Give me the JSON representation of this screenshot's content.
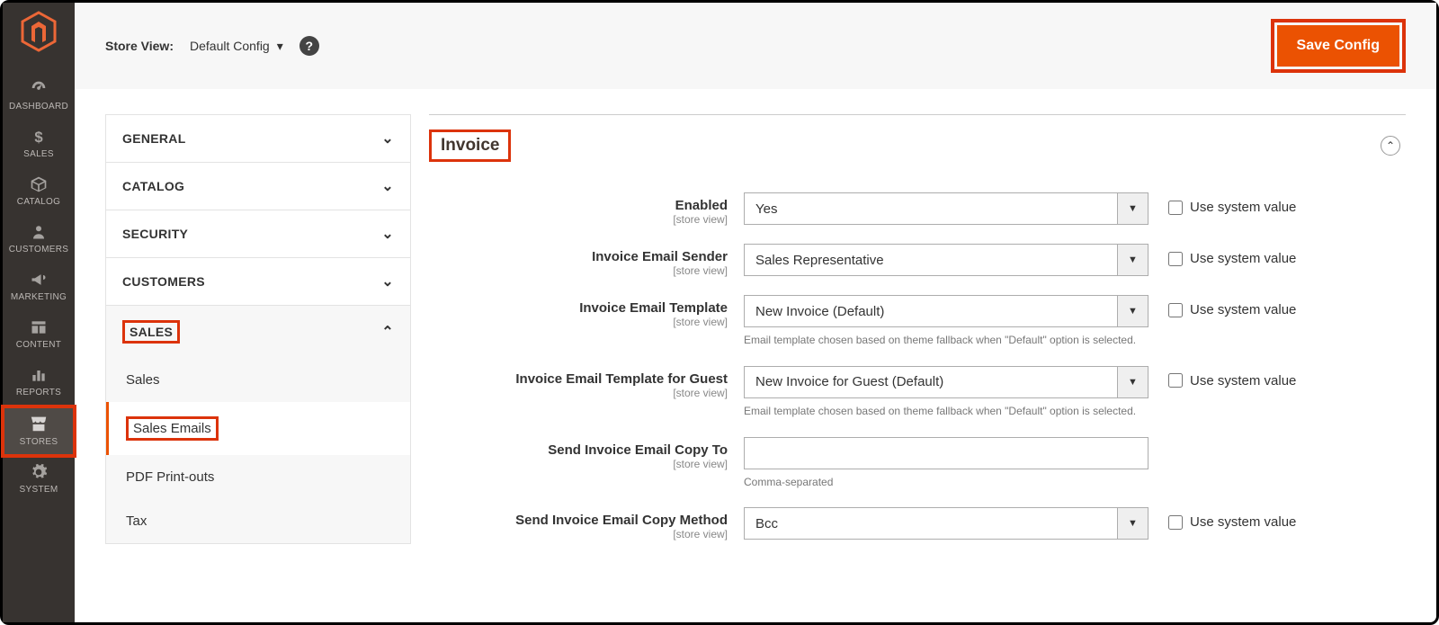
{
  "adminNav": {
    "items": [
      {
        "key": "dashboard",
        "label": "DASHBOARD"
      },
      {
        "key": "sales",
        "label": "SALES"
      },
      {
        "key": "catalog",
        "label": "CATALOG"
      },
      {
        "key": "customers",
        "label": "CUSTOMERS"
      },
      {
        "key": "marketing",
        "label": "MARKETING"
      },
      {
        "key": "content",
        "label": "CONTENT"
      },
      {
        "key": "reports",
        "label": "REPORTS"
      },
      {
        "key": "stores",
        "label": "STORES"
      },
      {
        "key": "system",
        "label": "SYSTEM"
      }
    ]
  },
  "topBar": {
    "storeViewLabel": "Store View:",
    "storeViewValue": "Default Config",
    "tooltipGlyph": "?",
    "saveLabel": "Save Config"
  },
  "configNav": {
    "sections": [
      {
        "label": "GENERAL",
        "expanded": false
      },
      {
        "label": "CATALOG",
        "expanded": false
      },
      {
        "label": "SECURITY",
        "expanded": false
      },
      {
        "label": "CUSTOMERS",
        "expanded": false
      },
      {
        "label": "SALES",
        "expanded": true,
        "highlight": true,
        "items": [
          {
            "label": "Sales"
          },
          {
            "label": "Sales Emails",
            "active": true,
            "highlight": true
          },
          {
            "label": "PDF Print-outs"
          },
          {
            "label": "Tax"
          }
        ]
      }
    ]
  },
  "settings": {
    "title": "Invoice",
    "scopeLabel": "[store view]",
    "useSystemLabel": "Use system value",
    "fields": {
      "enabled": {
        "label": "Enabled",
        "value": "Yes",
        "type": "select",
        "sys": true
      },
      "sender": {
        "label": "Invoice Email Sender",
        "value": "Sales Representative",
        "type": "select",
        "sys": true
      },
      "template": {
        "label": "Invoice Email Template",
        "value": "New Invoice (Default)",
        "type": "select",
        "sys": true,
        "helper": "Email template chosen based on theme fallback when \"Default\" option is selected."
      },
      "guestTemplate": {
        "label": "Invoice Email Template for Guest",
        "value": "New Invoice for Guest (Default)",
        "type": "select",
        "sys": true,
        "helper": "Email template chosen based on theme fallback when \"Default\" option is selected."
      },
      "copyTo": {
        "label": "Send Invoice Email Copy To",
        "value": "",
        "type": "text",
        "sys": false,
        "helper": "Comma-separated"
      },
      "copyMethod": {
        "label": "Send Invoice Email Copy Method",
        "value": "Bcc",
        "type": "select",
        "sys": true
      }
    }
  }
}
